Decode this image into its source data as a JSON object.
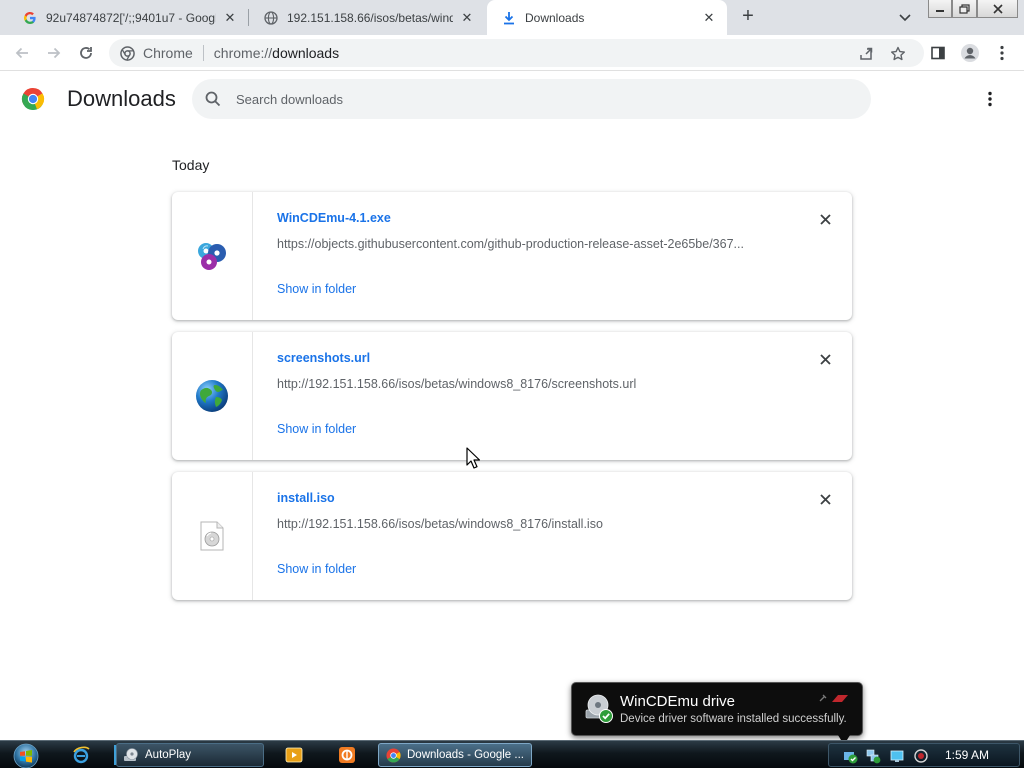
{
  "browser": {
    "tabs": [
      {
        "title": "92u74874872['/;;9401u7 - Google",
        "favicon": "google-g-icon",
        "active": false
      },
      {
        "title": "192.151.158.66/isos/betas/windo",
        "favicon": "globe-icon",
        "active": false
      },
      {
        "title": "Downloads",
        "favicon": "download-icon",
        "active": true
      }
    ],
    "omnibox": {
      "site_label": "Chrome",
      "url_scheme": "chrome://",
      "url_rest": "downloads"
    }
  },
  "downloads": {
    "title": "Downloads",
    "search_placeholder": "Search downloads",
    "section_label": "Today",
    "items": [
      {
        "name": "WinCDEmu-4.1.exe",
        "url": "https://objects.githubusercontent.com/github-production-release-asset-2e65be/367...",
        "action": "Show in folder",
        "icon": "wincdemu-discs-icon"
      },
      {
        "name": "screenshots.url",
        "url": "http://192.151.158.66/isos/betas/windows8_8176/screenshots.url",
        "action": "Show in folder",
        "icon": "globe-icon"
      },
      {
        "name": "install.iso",
        "url": "http://192.151.158.66/isos/betas/windows8_8176/install.iso",
        "action": "Show in folder",
        "icon": "disc-file-icon"
      }
    ]
  },
  "notification": {
    "title": "WinCDEmu drive",
    "message": "Device driver software installed successfully."
  },
  "taskbar": {
    "buttons": [
      {
        "label": "AutoPlay",
        "icon": "autoplay-icon",
        "active": false
      },
      {
        "label": "Downloads - Google ...",
        "icon": "chrome-icon",
        "active": true
      }
    ],
    "clock": "1:59 AM"
  },
  "colors": {
    "link": "#1a73e8",
    "tabstrip": "#dee1e6",
    "search_bg": "#f1f3f4"
  }
}
